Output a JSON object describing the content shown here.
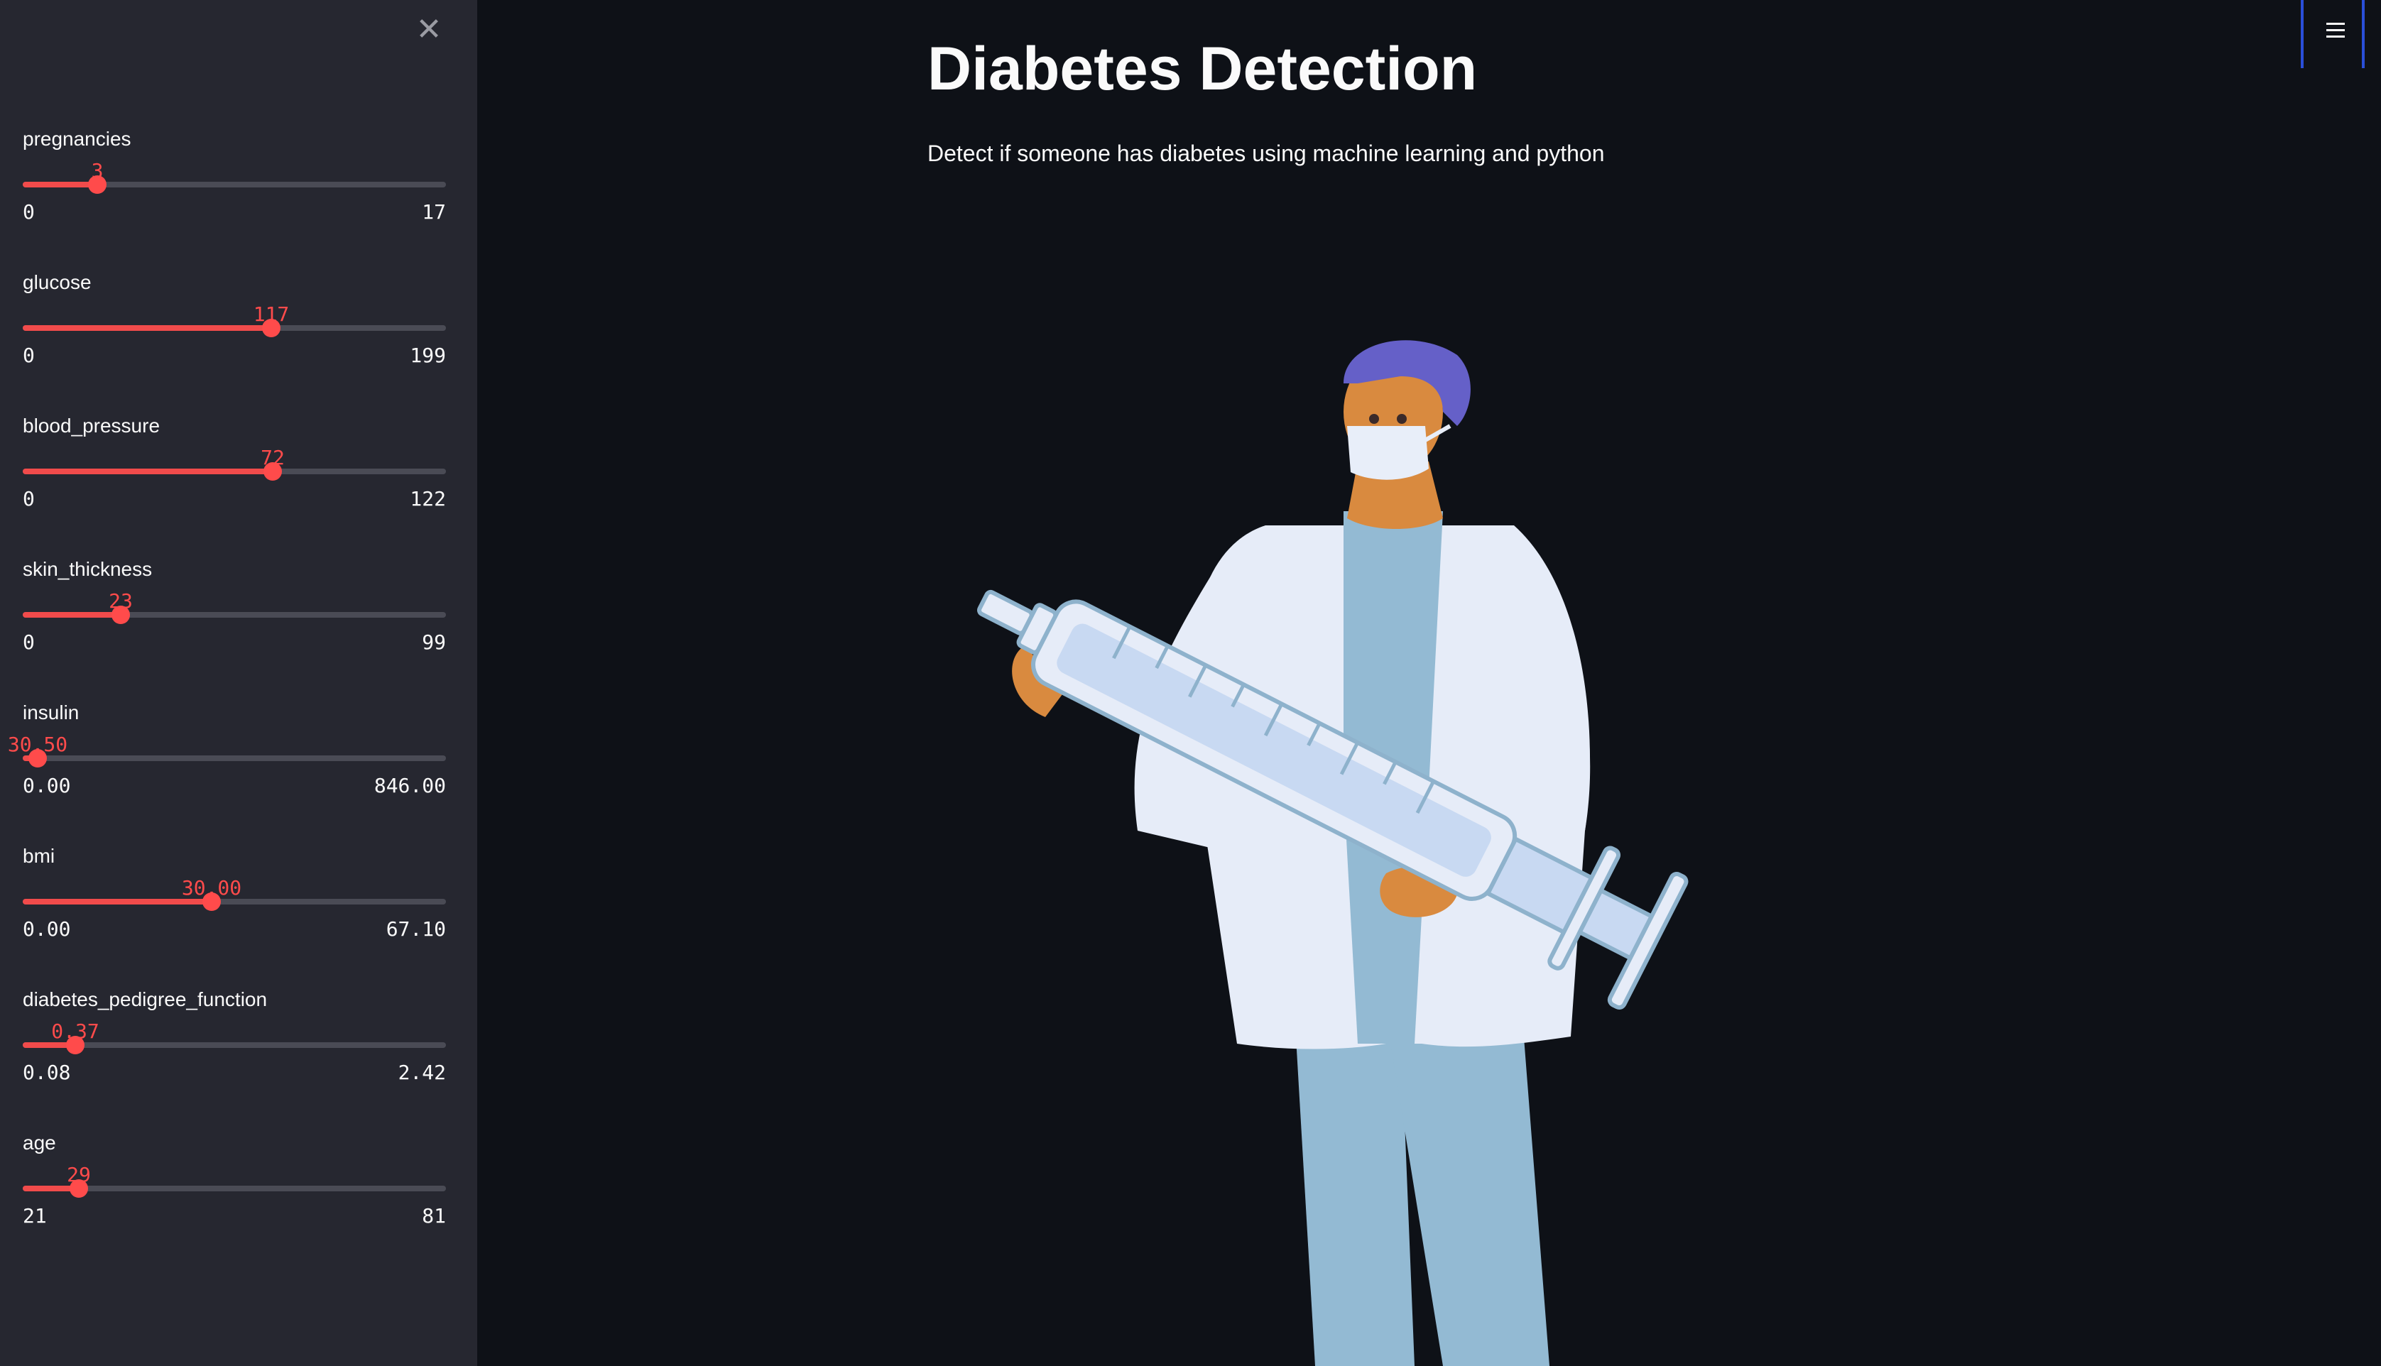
{
  "sidebar": {
    "close_icon": "close-icon",
    "sliders": [
      {
        "label": "pregnancies",
        "value": "3",
        "min": "0",
        "max": "17",
        "num": 3,
        "lo": 0,
        "hi": 17
      },
      {
        "label": "glucose",
        "value": "117",
        "min": "0",
        "max": "199",
        "num": 117,
        "lo": 0,
        "hi": 199
      },
      {
        "label": "blood_pressure",
        "value": "72",
        "min": "0",
        "max": "122",
        "num": 72,
        "lo": 0,
        "hi": 122
      },
      {
        "label": "skin_thickness",
        "value": "23",
        "min": "0",
        "max": "99",
        "num": 23,
        "lo": 0,
        "hi": 99
      },
      {
        "label": "insulin",
        "value": "30.50",
        "min": "0.00",
        "max": "846.00",
        "num": 30.5,
        "lo": 0,
        "hi": 846
      },
      {
        "label": "bmi",
        "value": "30.00",
        "min": "0.00",
        "max": "67.10",
        "num": 30.0,
        "lo": 0,
        "hi": 67.1
      },
      {
        "label": "diabetes_pedigree_function",
        "value": "0.37",
        "min": "0.08",
        "max": "2.42",
        "num": 0.37,
        "lo": 0.08,
        "hi": 2.42
      },
      {
        "label": "age",
        "value": "29",
        "min": "21",
        "max": "81",
        "num": 29,
        "lo": 21,
        "hi": 81
      }
    ]
  },
  "main": {
    "title": "Diabetes Detection",
    "subtitle": "Detect if someone has diabetes using machine learning and python",
    "illustration_icon": "doctor-with-syringe-illustration"
  },
  "header": {
    "menu_icon": "hamburger-menu-icon"
  },
  "colors": {
    "background": "#0e1117",
    "sidebar": "#262730",
    "accent": "#ff4b4b",
    "menu_border": "#2a4fd9"
  }
}
